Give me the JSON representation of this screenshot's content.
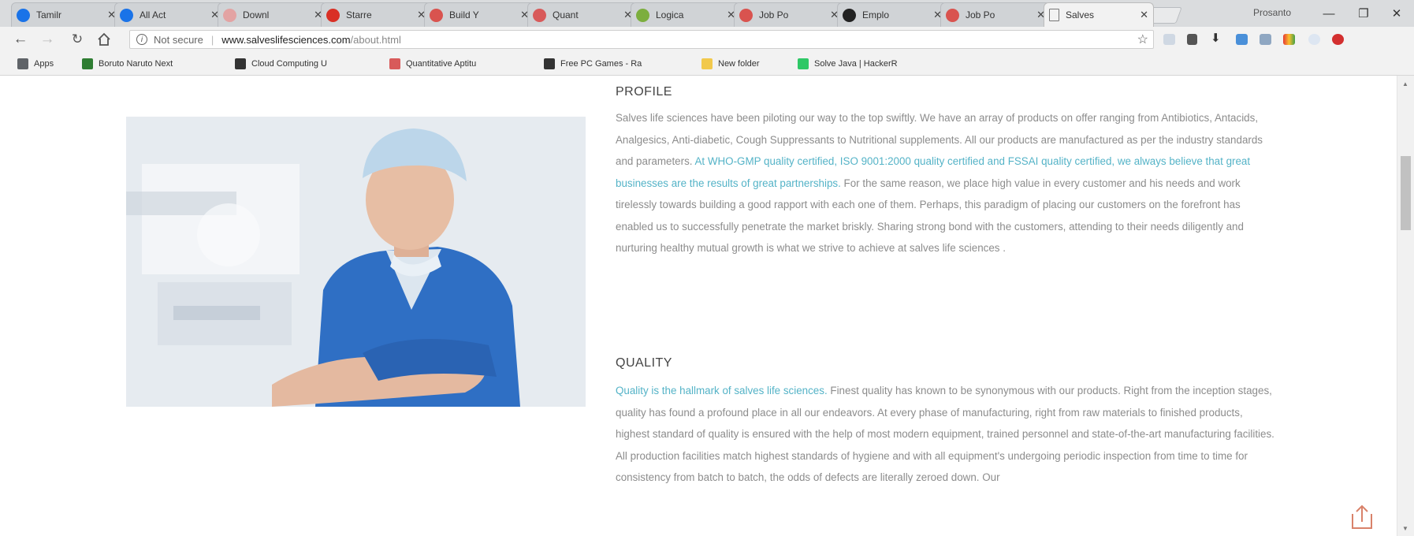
{
  "browser": {
    "tabs": [
      {
        "title": "Tamilr",
        "favicon": "chrome-circle-icon",
        "color": "#1a73e8"
      },
      {
        "title": "All Act",
        "favicon": "chrome-circle-icon",
        "color": "#1a73e8"
      },
      {
        "title": "Downl",
        "favicon": "download-icon",
        "color": "#e3a3a3"
      },
      {
        "title": "Starre",
        "favicon": "gmail-icon",
        "color": "#d93025"
      },
      {
        "title": "Build Y",
        "favicon": "site-logo-icon",
        "color": "#d9534f"
      },
      {
        "title": "Quant",
        "favicon": "quant-icon",
        "color": "#d85a5a"
      },
      {
        "title": "Logica",
        "favicon": "leaf-icon",
        "color": "#7cae3e"
      },
      {
        "title": "Job Po",
        "favicon": "site-logo-icon",
        "color": "#d9534f"
      },
      {
        "title": "Emplo",
        "favicon": "github-icon",
        "color": "#222222"
      },
      {
        "title": "Job Po",
        "favicon": "site-logo-icon",
        "color": "#d9534f"
      },
      {
        "title": "Salves",
        "favicon": "page-icon",
        "color": "#777777",
        "active": true
      }
    ],
    "profile_name": "Prosanto",
    "window_controls": {
      "minimize": "—",
      "maximize": "❐",
      "close": "✕"
    },
    "address_bar": {
      "security_label": "Not secure",
      "url_host": "www.salveslifesciences.com",
      "url_path": "/about.html"
    },
    "bookmarks": [
      {
        "label": "Apps",
        "icon": "apps-grid-icon",
        "color": "#5f6368"
      },
      {
        "label": "Boruto Naruto Next",
        "icon": "shield-icon",
        "color": "#2e7d32"
      },
      {
        "label": "Cloud Computing U",
        "icon": "book-icon",
        "color": "#333333"
      },
      {
        "label": "Quantitative Aptitu",
        "icon": "quant-icon",
        "color": "#d85a5a"
      },
      {
        "label": "Free PC Games - Ra",
        "icon": "gamepad-icon",
        "color": "#333333"
      },
      {
        "label": "New folder",
        "icon": "folder-icon",
        "color": "#f2c94c"
      },
      {
        "label": "Solve Java | HackerR",
        "icon": "hackerrank-icon",
        "color": "#2ec866"
      }
    ]
  },
  "page": {
    "profile": {
      "heading": "PROFILE",
      "text_before": "Salves life sciences have been piloting our way to the top swiftly. We have an array of products on offer ranging from Antibiotics, Antacids, Analgesics, Anti-diabetic, Cough Suppressants to Nutritional supplements. All our products are manufactured as per the industry standards and parameters. ",
      "highlight": "At WHO-GMP quality certified, ISO 9001:2000 quality certified and FSSAI quality certified, we always believe that great businesses are the results of great partnerships.",
      "text_after": " For the same reason, we place high value in every customer and his needs and work tirelessly towards building a good rapport with each one of them. Perhaps, this paradigm of placing our customers on the forefront has enabled us to successfully penetrate the market briskly. Sharing strong bond with the customers, attending to their needs diligently and nurturing healthy mutual growth is what we strive to achieve at salves life sciences ."
    },
    "quality": {
      "heading": "QUALITY",
      "highlight": "Quality is the hallmark of salves life sciences.",
      "text_after": " Finest quality has known to be synonymous with our products. Right from the inception stages, quality has found a profound place in all our endeavors. At every phase of manufacturing, right from raw materials to finished products, highest standard of quality is ensured with the help of most modern equipment, trained personnel and state-of-the-art manufacturing facilities. All production facilities match highest standards of hygiene and with all equipment's undergoing periodic inspection from time to time for consistency from batch to batch, the odds of defects are literally zeroed down. Our"
    }
  },
  "colors": {
    "highlight": "#54b3c7",
    "body_text": "#8c8c8c",
    "heading": "#444444",
    "scrub_blue": "#2f6fc4",
    "cap_blue": "#bcd6ea"
  }
}
